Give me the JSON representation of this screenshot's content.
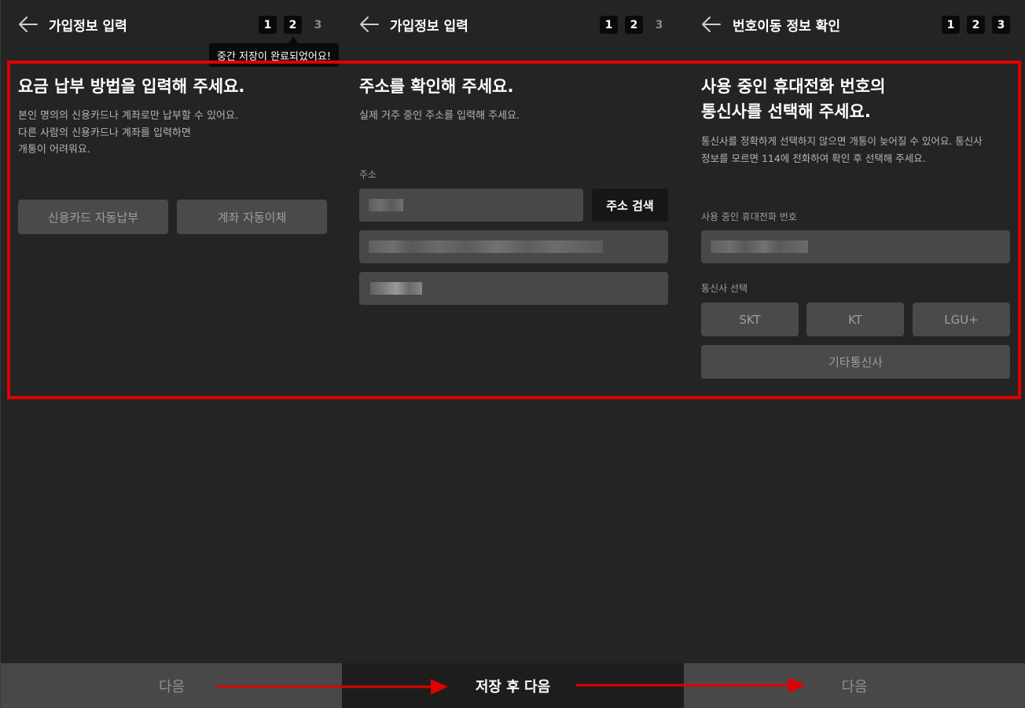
{
  "colors": {
    "background": "#242424",
    "highlight": "#e00000",
    "input_fill": "#484848",
    "button_disabled": "#4a4a4a",
    "button_dark": "#171717"
  },
  "screen1": {
    "back_icon": "arrow-left-icon",
    "title": "가입정보 입력",
    "steps": [
      "1",
      "2",
      "3"
    ],
    "current_step": 2,
    "tooltip": "중간 저장이 완료되었어요!",
    "heading": "요금 납부 방법을 입력해 주세요.",
    "desc_lines": [
      "본인 명의의 신용카드나 계좌로만 납부할 수 있어요.",
      "다른 사람의 신용카드나 계좌를 입력하면",
      "개통이 어려워요."
    ],
    "options": [
      "신용카드 자동납부",
      "계좌 자동이체"
    ],
    "cta": "다음",
    "cta_state": "disabled"
  },
  "screen2": {
    "back_icon": "arrow-left-icon",
    "title": "가입정보 입력",
    "steps": [
      "1",
      "2",
      "3"
    ],
    "current_step": 2,
    "heading": "주소를 확인해 주세요.",
    "desc": "실제 거주 중인 주소를 입력해 주세요.",
    "address_label": "주소",
    "search_button": "주소 검색",
    "cta": "저장 후 다음",
    "cta_state": "active"
  },
  "screen3": {
    "back_icon": "arrow-left-icon",
    "title": "번호이동 정보 확인",
    "steps": [
      "1",
      "2",
      "3"
    ],
    "current_step": 3,
    "heading_lines": [
      "사용 중인 휴대전화 번호의",
      "통신사를 선택해 주세요."
    ],
    "desc_lines": [
      "통신사를 정확하게 선택하지 않으면 개통이 늦어질 수 있어요. 통신사",
      "정보를 모르면 114에 전화하여 확인 후 선택해 주세요."
    ],
    "phone_label": "사용 중인 휴대전화 번호",
    "carrier_label": "통신사 선택",
    "carriers": [
      "SKT",
      "KT",
      "LGU+"
    ],
    "other_carrier": "기타통신사",
    "cta": "다음",
    "cta_state": "disabled"
  }
}
